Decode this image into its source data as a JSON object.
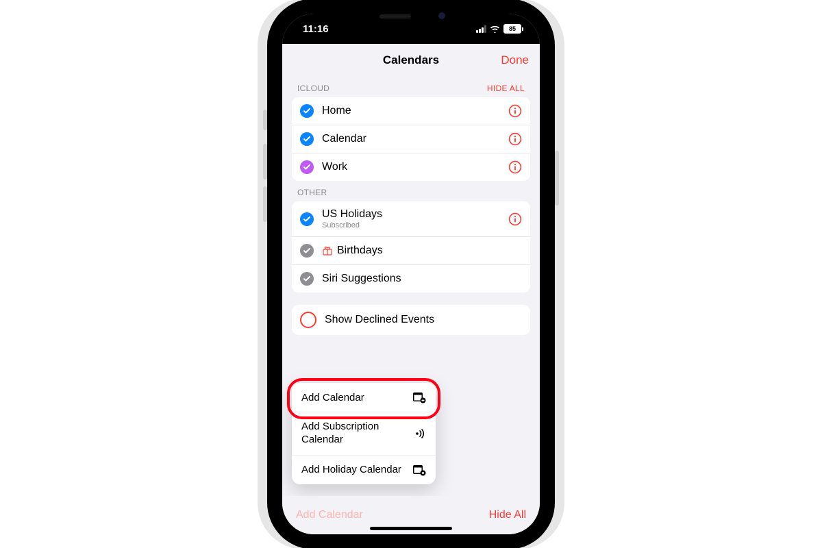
{
  "status": {
    "time": "11:16",
    "battery": "85"
  },
  "header": {
    "title": "Calendars",
    "done": "Done"
  },
  "sections": {
    "icloud": {
      "label": "ICLOUD",
      "action": "HIDE ALL",
      "items": [
        {
          "label": "Home"
        },
        {
          "label": "Calendar"
        },
        {
          "label": "Work"
        }
      ]
    },
    "other": {
      "label": "OTHER",
      "items": [
        {
          "label": "US Holidays",
          "sub": "Subscribed"
        },
        {
          "label": "Birthdays"
        },
        {
          "label": "Siri Suggestions"
        }
      ]
    },
    "declined": {
      "label": "Show Declined Events"
    }
  },
  "popup": {
    "add_calendar": "Add Calendar",
    "add_subscription": "Add Subscription Calendar",
    "add_holiday": "Add Holiday Calendar"
  },
  "footer": {
    "add": "Add Calendar",
    "hide": "Hide All"
  }
}
